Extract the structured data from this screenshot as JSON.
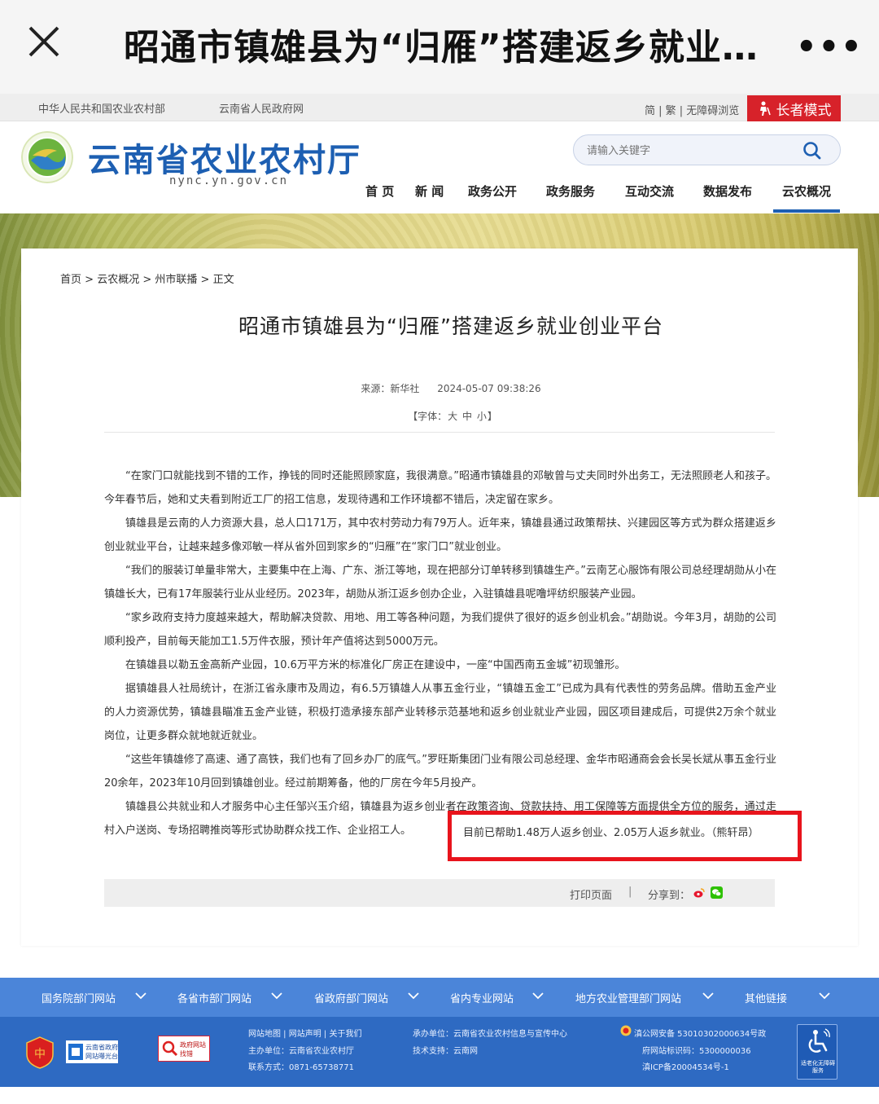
{
  "appbar": {
    "title": "昭通市镇雄县为“归雁”搭建返乡就业..."
  },
  "toplinks": {
    "link1": "中华人民共和国农业农村部",
    "link2": "云南省人民政府网",
    "accessibility": "简 | 繁 | 无障碍浏览",
    "elder_mode": "长者模式"
  },
  "header": {
    "site_name": "云南省农业农村厅",
    "site_url": "nync.yn.gov.cn",
    "search_placeholder": "请输入关键字",
    "nav": [
      "首 页",
      "新 闻",
      "政务公开",
      "政务服务",
      "互动交流",
      "数据发布",
      "云农概况"
    ],
    "active_nav": "云农概况"
  },
  "breadcrumb": {
    "home": "首页",
    "sep": " > ",
    "c1": "云农概况",
    "c2": "州市联播",
    "c3": "正文"
  },
  "article": {
    "title": "昭通市镇雄县为“归雁”搭建返乡就业创业平台",
    "source": "来源：新华社",
    "datetime": "2024-05-07 09:38:26",
    "font_label_open": "【字体：",
    "font_large": "大",
    "font_medium": "中",
    "font_small": "小",
    "font_label_close": "】",
    "paragraphs": [
      "“在家门口就能找到不错的工作，挣钱的同时还能照顾家庭，我很满意。”昭通市镇雄县的邓敏曾与丈夫同时外出务工，无法照顾老人和孩子。今年春节后，她和丈夫看到附近工厂的招工信息，发现待遇和工作环境都不错后，决定留在家乡。",
      "镇雄县是云南的人力资源大县，总人口171万，其中农村劳动力有79万人。近年来，镇雄县通过政策帮扶、兴建园区等方式为群众搭建返乡创业就业平台，让越来越多像邓敏一样从省外回到家乡的“归雁”在“家门口”就业创业。",
      "“我们的服装订单量非常大，主要集中在上海、广东、浙江等地，现在把部分订单转移到镇雄生产。”云南艺心服饰有限公司总经理胡勋从小在镇雄长大，已有17年服装行业从业经历。2023年，胡勋从浙江返乡创办企业，入驻镇雄县呢噜坪纺织服装产业园。",
      "“家乡政府支持力度越来越大，帮助解决贷款、用地、用工等各种问题，为我们提供了很好的返乡创业机会。”胡勋说。今年3月，胡勋的公司顺利投产，目前每天能加工1.5万件衣服，预计年产值将达到5000万元。",
      "在镇雄县以勒五金高新产业园，10.6万平方米的标准化厂房正在建设中，一座“中国西南五金城”初现雏形。",
      "据镇雄县人社局统计，在浙江省永康市及周边，有6.5万镇雄人从事五金行业，“镇雄五金工”已成为具有代表性的劳务品牌。借助五金产业的人力资源优势，镇雄县瞄准五金产业链，积极打造承接东部产业转移示范基地和返乡创业就业产业园，园区项目建成后，可提供2万余个就业岗位，让更多群众就地就近就业。",
      "“这些年镇雄修了高速、通了高铁，我们也有了回乡办厂的底气。”罗旺斯集团门业有限公司总经理、金华市昭通商会会长吴长斌从事五金行业20余年，2023年10月回到镇雄创业。经过前期筹备，他的厂房在今年5月投产。",
      "镇雄县公共就业和人才服务中心主任邹兴玉介绍，镇雄县为返乡创业者在政策咨询、贷款扶持、用工保障等方面提供全方位的服务，通过走村入户送岗、专场招聘推岗等形式协助群众找工作、企业招工人。"
    ],
    "highlight": "目前已帮助1.48万人返乡创业、2.05万人返乡就业。（熊轩昂）",
    "print": "打印页面",
    "sep": "|",
    "share": "分享到："
  },
  "footer": {
    "links": [
      "国务院部门网站",
      "各省市部门网站",
      "省政府部门网站",
      "省内专业网站",
      "地方农业管理部门网站",
      "其他链接"
    ],
    "col1": [
      "网站地图 | 网站声明 | 关于我们",
      "主办单位：云南省农业农村厅",
      "联系方式：0871-65738771"
    ],
    "col2": [
      "承办单位：云南省农业农村信息与宣传中心",
      "技术支持：云南网"
    ],
    "col3": [
      "滇公网安备 53010302000634号政",
      "府网站标识码：5300000036",
      "滇ICP备20004534号-1"
    ],
    "badge2_text": "云南省政府网站曝光台",
    "badge3_text": "政府网站找错",
    "acc_text": "适老化无障碍服务"
  },
  "colors": {
    "brand_blue": "#1d5fb2",
    "elder_red": "#d7222a",
    "highlight_red": "#e8141c",
    "footer_blue": "#2e6ac2"
  }
}
